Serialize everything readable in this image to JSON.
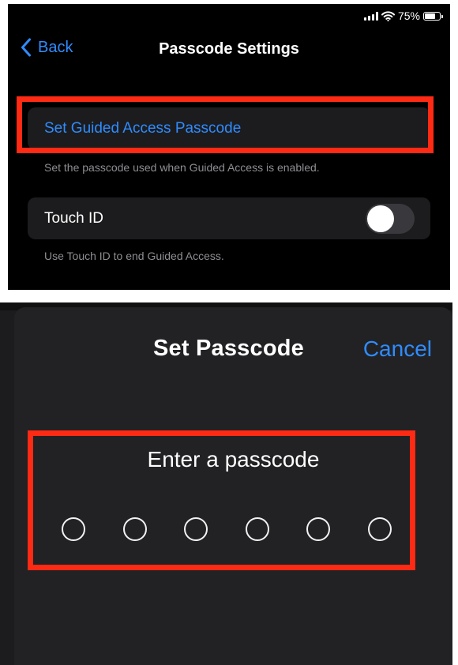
{
  "status_bar": {
    "battery_text": "75%",
    "battery_level": 0.75,
    "icons": [
      "cellular-signal-icon",
      "wifi-icon",
      "battery-icon"
    ]
  },
  "nav": {
    "back_label": "Back",
    "back_icon": "chevron-left-icon",
    "title": "Passcode Settings"
  },
  "settings": {
    "guided_passcode": {
      "label": "Set Guided Access Passcode",
      "footer": "Set the passcode used when Guided Access is enabled."
    },
    "touch_id": {
      "label": "Touch ID",
      "enabled": false,
      "footer": "Use Touch ID to end Guided Access."
    }
  },
  "passcode_sheet": {
    "title": "Set Passcode",
    "cancel_label": "Cancel",
    "prompt": "Enter a passcode",
    "digit_count": 6,
    "digits_entered": 0
  },
  "colors": {
    "accent": "#2f8cff",
    "highlight": "#ff2a14",
    "background": "#000000",
    "cell": "#1c1c1e",
    "sheet": "#222224"
  }
}
